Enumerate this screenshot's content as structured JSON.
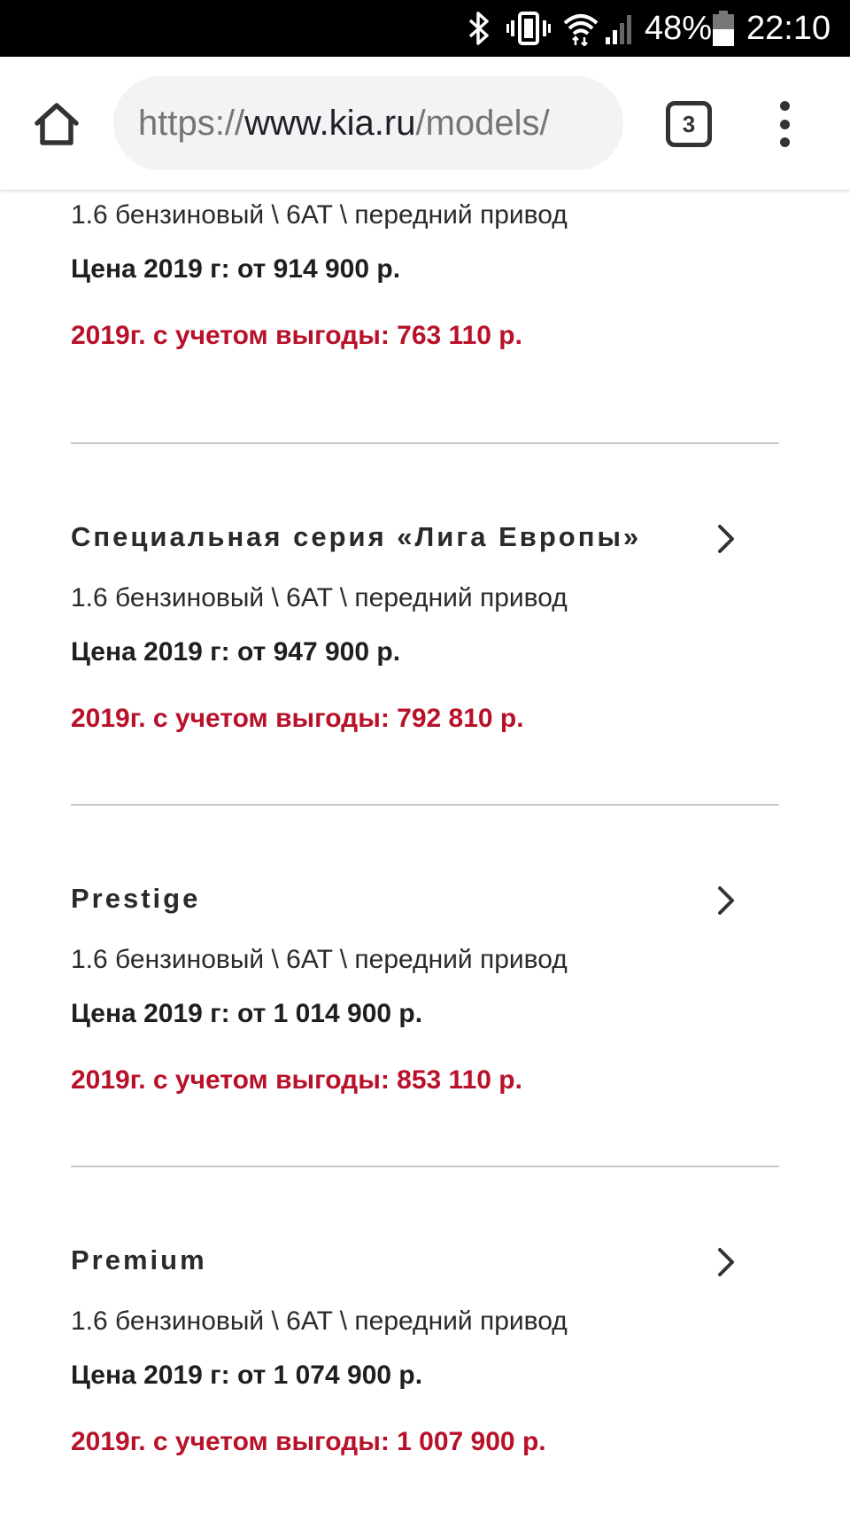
{
  "status_bar": {
    "battery": "48%",
    "time": "22:10"
  },
  "browser": {
    "url_scheme": "https://",
    "url_host": "www.kia.ru",
    "url_path": "/models/",
    "tab_count": "3"
  },
  "trims": [
    {
      "name": "",
      "spec": "1.6 бензиновый \\ 6AT \\ передний привод",
      "price": "Цена 2019 г: от 914 900 р.",
      "promo": "2019г. с учетом выгоды: 763 110 р."
    },
    {
      "name": "Специальная серия «Лига Европы»",
      "spec": "1.6 бензиновый \\ 6AT \\ передний привод",
      "price": "Цена 2019 г: от 947 900 р.",
      "promo": "2019г. с учетом выгоды: 792 810 р."
    },
    {
      "name": "Prestige",
      "spec": "1.6 бензиновый \\ 6AT \\ передний привод",
      "price": "Цена 2019 г: от 1 014 900 р.",
      "promo": "2019г. с учетом выгоды: 853 110 р."
    },
    {
      "name": "Premium",
      "spec": "1.6 бензиновый \\ 6AT \\ передний привод",
      "price": "Цена 2019 г: от 1 074 900 р.",
      "promo": "2019г. с учетом выгоды: 1 007 900 р."
    }
  ],
  "colors": {
    "promo_red": "#b8122a",
    "divider": "#c8c8c8",
    "url_bar_bg": "#f1f3f4"
  }
}
